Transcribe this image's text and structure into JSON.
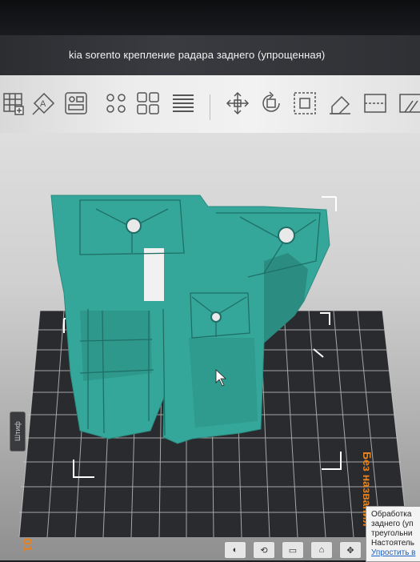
{
  "window": {
    "title": "kia sorento крепление радара заднего (упрощенная)"
  },
  "toolbar": {
    "tools": [
      "grid-icon",
      "auto-arrange-icon",
      "layout-icon",
      "multi-copy-icon",
      "multi-layout-icon",
      "layers-icon",
      "move-icon",
      "rotate-icon",
      "scale-icon",
      "erase-icon",
      "split-icon",
      "support-icon"
    ]
  },
  "viewport": {
    "side_label": "Без названия",
    "left_tab": "Штиф",
    "plate_number": "01",
    "model_color": "#35a79a",
    "plate_color": "#2a2b2e",
    "grid_color": "#cfcfcf"
  },
  "notification": {
    "line1": "Обработка",
    "line2": "заднего (уп",
    "line3": "треугольни",
    "line4": "Настоятель",
    "link": "Упростить в"
  },
  "bottom_controls": [
    "◐",
    "⟲",
    "▭",
    "⌂",
    "✥"
  ]
}
